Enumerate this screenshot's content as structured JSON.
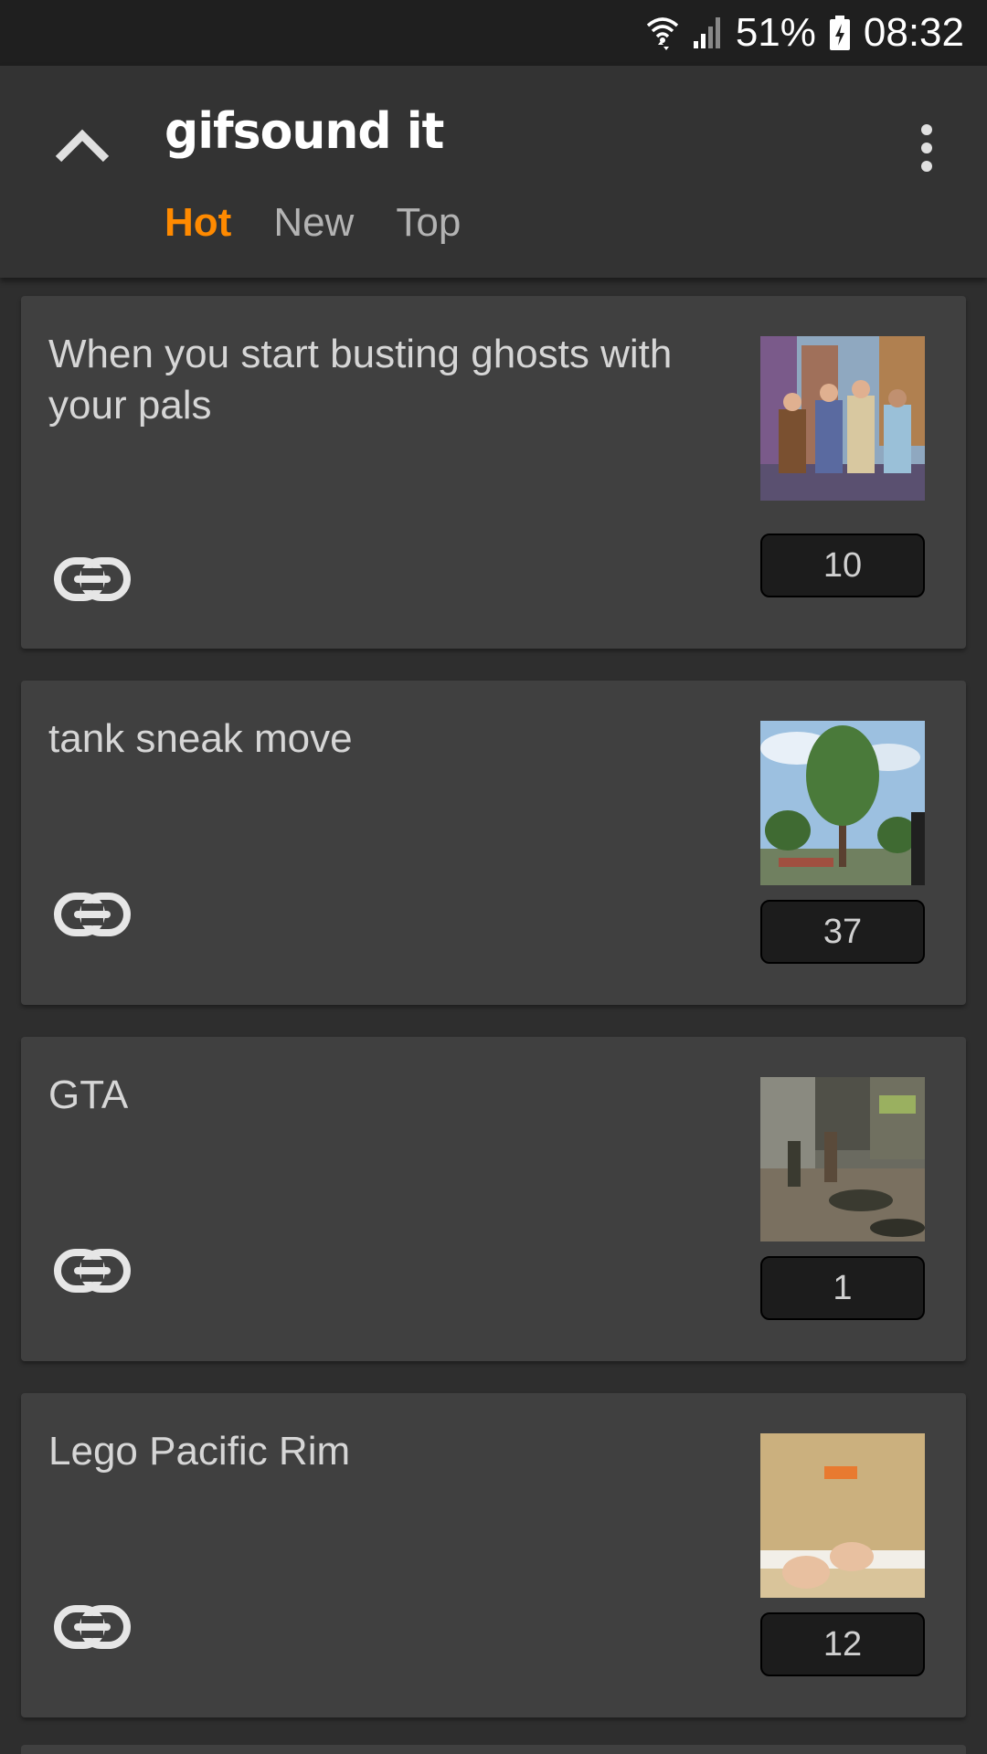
{
  "status_bar": {
    "battery": "51%",
    "time": "08:32",
    "icons": [
      "wifi-icon",
      "signal-icon",
      "battery-icon"
    ]
  },
  "app_bar": {
    "logo": "GIFSOUND IT",
    "back_icon": "chevron-up-icon",
    "menu_icon": "more-vert-icon",
    "tabs": [
      {
        "label": "Hot",
        "active": true
      },
      {
        "label": "New",
        "active": false
      },
      {
        "label": "Top",
        "active": false
      }
    ]
  },
  "colors": {
    "accent": "#ff8a00",
    "background": "#2e2e2e",
    "card": "#404040",
    "app_bar": "#333333"
  },
  "posts": [
    {
      "title": "When you start busting ghosts with your pals",
      "score": "10",
      "thumbnail": "cartoon-ghostbusters",
      "link_icon": "link-icon"
    },
    {
      "title": "tank sneak move",
      "score": "37",
      "thumbnail": "tree-sky",
      "link_icon": "link-icon"
    },
    {
      "title": "GTA",
      "score": "1",
      "thumbnail": "street-scene",
      "link_icon": "link-icon"
    },
    {
      "title": "Lego Pacific Rim",
      "score": "12",
      "thumbnail": "cardboard-hands",
      "link_icon": "link-icon"
    }
  ]
}
